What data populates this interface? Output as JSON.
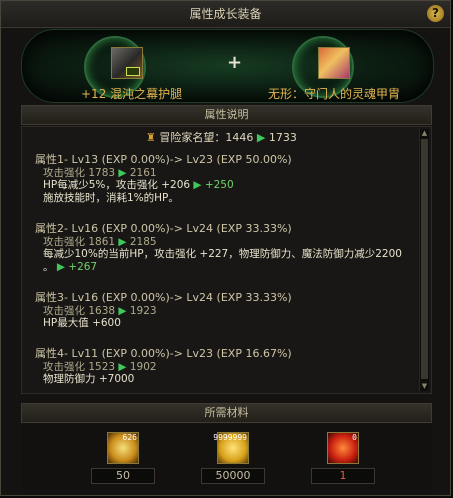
{
  "window": {
    "title": "属性成长装备"
  },
  "left_item": {
    "name": "+12 混沌之幕护腿",
    "icon": "armor-leg-icon"
  },
  "right_item": {
    "name": "无形：守门人的灵魂甲胄",
    "icon": "armor-chest-icon"
  },
  "plus_sign": "+",
  "attr_section": {
    "title": "属性说明",
    "fame": {
      "label": "冒险家名望：1446",
      "arrow": "▶",
      "after": "1733"
    },
    "blocks": [
      {
        "header": "属性1- Lv13 (EXP 0.00%)-> Lv23 (EXP 50.00%)",
        "lines": [
          {
            "text": "攻击强化 1783",
            "arrow": "▶",
            "after": "2161"
          },
          {
            "text": "HP每减少5%，攻击强化 +206",
            "arrow": "▶",
            "after": "+250"
          },
          {
            "text": "施放技能时，消耗1%的HP。",
            "arrow": "",
            "after": ""
          }
        ]
      },
      {
        "header": "属性2- Lv16 (EXP 0.00%)-> Lv24 (EXP 33.33%)",
        "lines": [
          {
            "text": "攻击强化 1861",
            "arrow": "▶",
            "after": "2185"
          },
          {
            "text": "每减少10%的当前HP，攻击强化 +227，物理防御力、魔法防御力减少2200",
            "arrow": "",
            "after": ""
          },
          {
            "text": "。",
            "arrow": "▶",
            "after": "+267"
          }
        ]
      },
      {
        "header": "属性3- Lv16 (EXP 0.00%)-> Lv24 (EXP 33.33%)",
        "lines": [
          {
            "text": "攻击强化 1638",
            "arrow": "▶",
            "after": "1923"
          },
          {
            "text": "HP最大值 +600",
            "arrow": "",
            "after": ""
          }
        ]
      },
      {
        "header": "属性4- Lv11 (EXP 0.00%)-> Lv23 (EXP 16.67%)",
        "lines": [
          {
            "text": "攻击强化 1523",
            "arrow": "▶",
            "after": "1902"
          },
          {
            "text": "物理防御力 +7000",
            "arrow": "",
            "after": ""
          }
        ]
      }
    ]
  },
  "materials": {
    "title": "所需材料",
    "items": [
      {
        "icon": "gem-icon",
        "stack": "626",
        "qty": "50"
      },
      {
        "icon": "gold-coin-icon",
        "stack": "9999999",
        "qty": "50000"
      },
      {
        "icon": "fire-orb-icon",
        "stack": "0",
        "qty": "1"
      }
    ]
  },
  "help_label": "?"
}
